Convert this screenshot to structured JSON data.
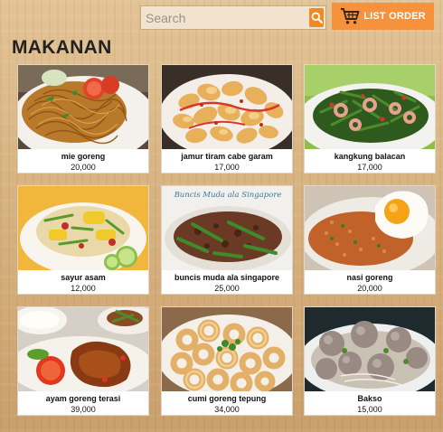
{
  "search": {
    "placeholder": "Search"
  },
  "header": {
    "list_order_label": "LIST ORDER"
  },
  "page_title": "MAKANAN",
  "menu_items": [
    {
      "name": "mie goreng",
      "price": "20,000"
    },
    {
      "name": "jamur tiram cabe garam",
      "price": "17,000"
    },
    {
      "name": "kangkung balacan",
      "price": "17,000"
    },
    {
      "name": "sayur asam",
      "price": "12,000"
    },
    {
      "name": "buncis muda ala singapore",
      "price": "25,000"
    },
    {
      "name": "nasi goreng",
      "price": "20,000"
    },
    {
      "name": "ayam goreng terasi",
      "price": "39,000"
    },
    {
      "name": "cumi goreng tepung",
      "price": "34,000"
    },
    {
      "name": "Bakso",
      "price": "15,000"
    }
  ],
  "image_overlay_text": {
    "buncis_caption": "Buncis Muda ala Singapore"
  },
  "colors": {
    "accent": "#f5923b",
    "search_button": "#f08a24"
  },
  "icons": {
    "search": "search-icon",
    "cart": "cart-icon"
  }
}
